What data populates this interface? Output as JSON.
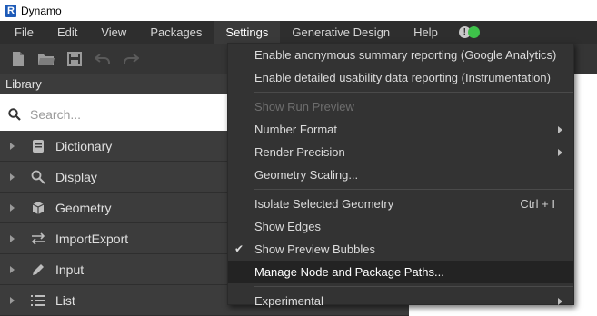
{
  "window": {
    "title": "Dynamo",
    "logo_letter": "R"
  },
  "menubar": {
    "items": [
      {
        "label": "File"
      },
      {
        "label": "Edit"
      },
      {
        "label": "View"
      },
      {
        "label": "Packages"
      },
      {
        "label": "Settings"
      },
      {
        "label": "Generative Design"
      },
      {
        "label": "Help"
      }
    ],
    "active": "Settings",
    "notification_glyph": "!"
  },
  "toolbar": {
    "icons": [
      "new-file-icon",
      "open-folder-icon",
      "save-icon",
      "undo-icon",
      "redo-icon"
    ]
  },
  "library": {
    "title": "Library",
    "search": {
      "placeholder": "Search...",
      "value": ""
    },
    "categories": [
      {
        "label": "Dictionary",
        "icon": "dictionary-icon"
      },
      {
        "label": "Display",
        "icon": "magnifier-icon"
      },
      {
        "label": "Geometry",
        "icon": "cube-icon"
      },
      {
        "label": "ImportExport",
        "icon": "arrows-icon"
      },
      {
        "label": "Input",
        "icon": "pencil-icon"
      },
      {
        "label": "List",
        "icon": "list-icon"
      }
    ]
  },
  "settings_menu": {
    "items": [
      {
        "label": "Enable anonymous summary reporting (Google Analytics)"
      },
      {
        "label": "Enable detailed usability data reporting (Instrumentation)"
      },
      {
        "label": "Show Run Preview",
        "disabled": true
      },
      {
        "label": "Number Format",
        "submenu": true
      },
      {
        "label": "Render Precision",
        "submenu": true
      },
      {
        "label": "Geometry Scaling..."
      },
      {
        "label": "Isolate Selected Geometry",
        "shortcut": "Ctrl + I"
      },
      {
        "label": "Show Edges"
      },
      {
        "label": "Show Preview Bubbles",
        "checked": true,
        "check_glyph": "✔"
      },
      {
        "label": "Manage Node and Package Paths...",
        "highlighted": true
      },
      {
        "label": "Experimental",
        "submenu": true
      }
    ]
  },
  "colors": {
    "menubar_bg": "#2e2e2e",
    "toolbar_bg": "#353535",
    "panel_bg": "#3c3c3c",
    "dropdown_bg": "#333333",
    "accent_green": "#3ec24a"
  }
}
